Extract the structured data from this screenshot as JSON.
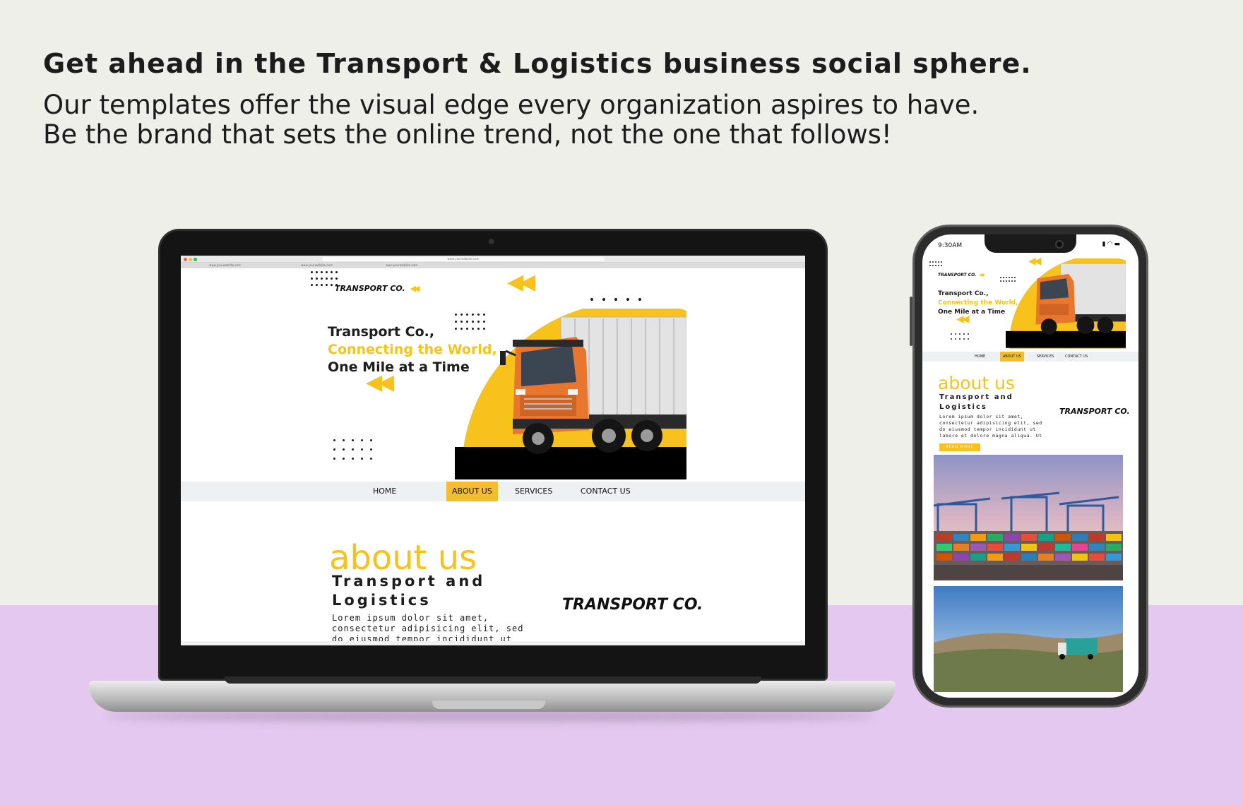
{
  "ad": {
    "headline": "Get ahead in the Transport & Logistics business social sphere.",
    "subline_1": "Our templates offer the visual edge every organization aspires to have.",
    "subline_2": "Be the brand that sets the online trend, not the one that follows!"
  },
  "colors": {
    "accent_yellow": "#f6c21b",
    "nav_active": "#f2be2f",
    "background": "#efefea",
    "floor": "#e4c8ef",
    "truck_orange": "#e8762e"
  },
  "site": {
    "logo": "TRANSPORT CO.",
    "hero": {
      "line1": "Transport Co.,",
      "line2": "Connecting the World,",
      "line3": "One Mile at a Time"
    },
    "nav": [
      {
        "label": "HOME",
        "active": false
      },
      {
        "label": "ABOUT US",
        "active": true
      },
      {
        "label": "SERVICES",
        "active": false
      },
      {
        "label": "CONTACT US",
        "active": false
      }
    ],
    "about": {
      "title": "about us",
      "subtitle_1": "Transport and",
      "subtitle_2": "Logistics",
      "body_desktop": "Lorem ipsum dolor sit amet, consectetur adipisicing elit, sed do eiusmod tempor incididunt ut",
      "body_mobile": "Lorem ipsum dolor sit amet, consectetur adipisicing elit, sed do eiusmod tempor incididunt ut labore et dolore magna aliqua. Ut",
      "read_more": "READ MORE",
      "logo": "TRANSPORT CO."
    }
  },
  "browser": {
    "url": "www.yourwebsite.com",
    "tabs": [
      "www.yourwebsite.com",
      "www.yourwebsite.com",
      "www.yourwebsite.com"
    ]
  },
  "phone": {
    "time": "9:30AM",
    "status_icons": [
      "signal-icon",
      "wifi-icon",
      "battery-icon"
    ]
  }
}
